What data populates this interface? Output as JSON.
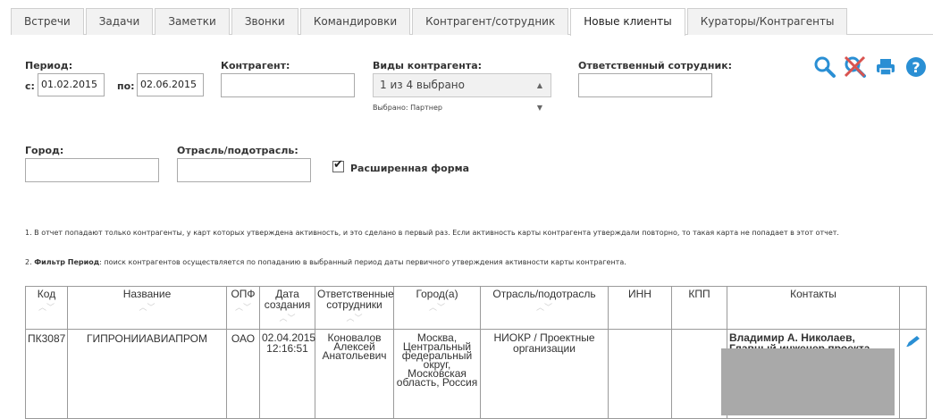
{
  "tabs": [
    {
      "label": "Встречи"
    },
    {
      "label": "Задачи"
    },
    {
      "label": "Заметки"
    },
    {
      "label": "Звонки"
    },
    {
      "label": "Командировки"
    },
    {
      "label": "Контрагент/сотрудник"
    },
    {
      "label": "Новые клиенты",
      "active": true
    },
    {
      "label": "Кураторы/Контрагенты"
    }
  ],
  "filters": {
    "period_label": "Период:",
    "from_label": "с:",
    "from_value": "01.02.2015",
    "to_label": "по:",
    "to_value": "02.06.2015",
    "counterparty_label": "Контрагент:",
    "counterparty_value": "",
    "types_label": "Виды контрагента:",
    "types_value": "1 из 4 выбрано",
    "types_selected_note": "Выбрано: Партнер",
    "employee_label": "Ответственный сотрудник:",
    "employee_value": "",
    "city_label": "Город:",
    "city_value": "",
    "industry_label": "Отрасль/подотрасль:",
    "industry_value": "",
    "extended_label": "Расширенная форма",
    "extended_checked": true
  },
  "notes": {
    "note1": "1. В отчет попадают только контрагенты, у карт которых утверждена активность, и это сделано в первый раз. Если активность карты контрагента утверждали повторно, то такая карта не попадает в этот отчет.",
    "note2_prefix": "2.",
    "note2_bold": "Фильтр Период",
    "note2_rest": ": поиск контрагентов осуществляется по попаданию в выбранный период даты первичного утверждения активности карты контрагента."
  },
  "icons": [
    "search-icon",
    "clear-filter-icon",
    "print-icon",
    "help-icon"
  ],
  "colors": {
    "icon_blue": "#2a8fd4",
    "icon_red": "#d9534f",
    "tab_bg": "#f2f2f2"
  },
  "table": {
    "headers": {
      "code": "Код",
      "name": "Название",
      "opf": "ОПФ",
      "created_1": "Дата",
      "created_2": "создания",
      "resp_1": "Ответственные",
      "resp_2": "сотрудники",
      "city": "Город(а)",
      "industry": "Отрасль/подотрасль",
      "inn": "ИНН",
      "kpp": "КПП",
      "contacts": "Контакты",
      "sort": "^ v"
    },
    "row": {
      "code": "ПК3087",
      "name": "ГИПРОНИИАВИАПРОМ",
      "opf": "ОАО",
      "date": "02.04.2015",
      "time": "12:16:51",
      "resp_1": "Коновалов",
      "resp_2": "Алексей",
      "resp_3": "Анатольевич",
      "city_1": "Москва,",
      "city_2": "Центральный",
      "city_3": "федеральный",
      "city_4": "округ, Московская",
      "city_5": "область, Россия",
      "industry": "НИОКР / Проектные организации",
      "inn": "",
      "kpp": "",
      "contact_1": "Владимир А. Николаев,",
      "contact_2": "Главный инженер проекта"
    }
  }
}
